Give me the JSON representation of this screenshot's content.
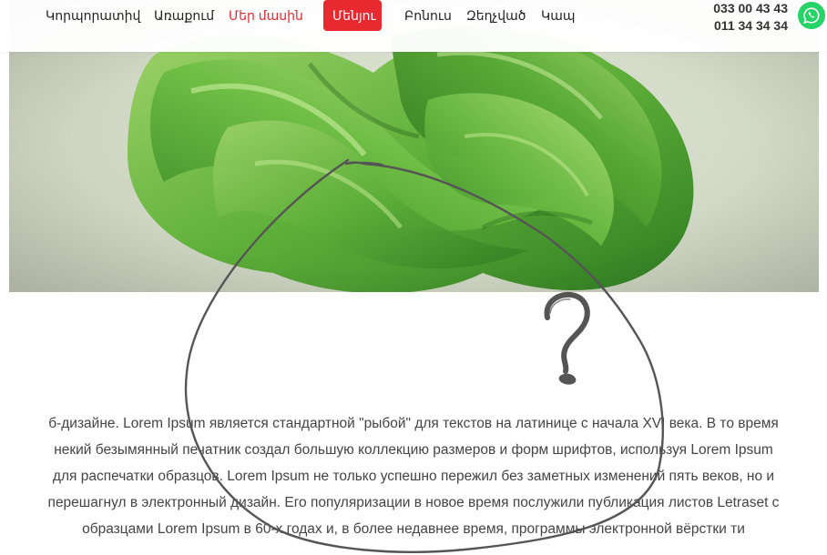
{
  "nav": {
    "items": [
      {
        "label": "Կորպորատիվ",
        "state": "normal"
      },
      {
        "label": "Առաքում",
        "state": "normal"
      },
      {
        "label": "Մեր մասին",
        "state": "active"
      },
      {
        "label": "Մենյու",
        "state": "pill"
      },
      {
        "label": "Բոնուս",
        "state": "normal"
      },
      {
        "label": "Զեղչված",
        "state": "normal"
      },
      {
        "label": "Կապ",
        "state": "normal"
      }
    ]
  },
  "contact": {
    "phone_1": "033 00 43 43",
    "phone_2": "011 34 34 34",
    "whatsapp_icon": "whatsapp-icon"
  },
  "hero": {
    "image": "green-abstract-ribbon-art"
  },
  "doodle": {
    "shape": "hand-drawn-ellipse",
    "icon": "question-mark-icon"
  },
  "content": {
    "paragraph": "б-дизайне. Lorem Ipsum является стандартной \"рыбой\" для текстов на латинице с начала XVI века. В то время некий безымянный печатник создал большую коллекцию размеров и форм шрифтов, используя Lorem Ipsum для распечатки образцов. Lorem Ipsum не только успешно пережил без заметных изменений пять веков, но и перешагнул в электронный дизайн. Его популяризации в новое время послужили публикация листов Letraset с образцами Lorem Ipsum в 60-х годах и, в более недавнее время, программы электронной вёрстки ти"
  },
  "colors": {
    "accent": "#e8292f",
    "whatsapp": "#25d366",
    "text": "#444444",
    "doodle": "#555555"
  }
}
